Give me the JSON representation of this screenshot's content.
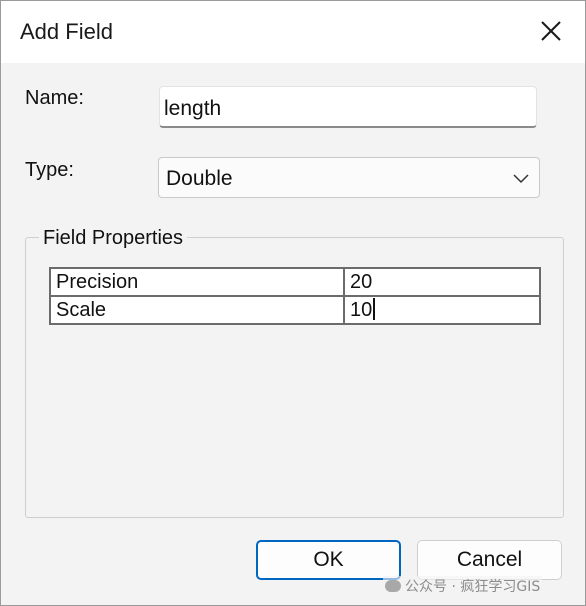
{
  "dialog": {
    "title": "Add Field",
    "close_icon": "close-icon"
  },
  "form": {
    "name_label": "Name:",
    "name_value": "length",
    "type_label": "Type:",
    "type_value": "Double",
    "type_dropdown_icon": "chevron-down-icon"
  },
  "field_properties": {
    "title": "Field Properties",
    "rows": [
      {
        "key": "Precision",
        "value": "20"
      },
      {
        "key": "Scale",
        "value": "10"
      }
    ]
  },
  "buttons": {
    "ok_label": "OK",
    "cancel_label": "Cancel"
  },
  "watermark": {
    "text": "公众号 · 疯狂学习GIS"
  },
  "colors": {
    "accent": "#0067c0",
    "window_bg": "#f3f3f3"
  }
}
